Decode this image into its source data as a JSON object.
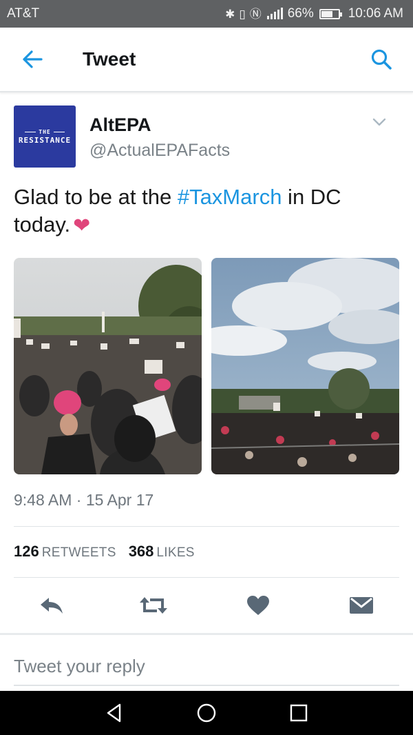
{
  "status_bar": {
    "carrier": "AT&T",
    "battery_text": "66%",
    "battery_level": 0.66,
    "time": "10:06 AM",
    "icons": [
      "bluetooth-icon",
      "vibrate-icon",
      "nfc-icon",
      "signal-icon",
      "battery-icon"
    ]
  },
  "header": {
    "title": "Tweet",
    "back_icon": "back-arrow-icon",
    "search_icon": "search-icon",
    "accent": "#1b95e0"
  },
  "tweet": {
    "avatar": {
      "line1": "THE",
      "line2": "RESISTANCE",
      "bg": "#2b3a9f"
    },
    "author_name": "AltEPA",
    "author_handle": "@ActualEPAFacts",
    "text_before": "Glad to be at the ",
    "hashtag": "#TaxMarch",
    "text_after": " in DC today.",
    "emoji": "❤",
    "photos": [
      "crowd-photo-capitol",
      "crowd-photo-sky"
    ],
    "timestamp": "9:48 AM · 15 Apr 17",
    "retweets_count": "126",
    "retweets_label": "RETWEETS",
    "likes_count": "368",
    "likes_label": "LIKES",
    "actions": [
      "reply-icon",
      "retweet-icon",
      "like-icon",
      "direct-message-icon"
    ]
  },
  "reply": {
    "placeholder": "Tweet your reply"
  },
  "nav": {
    "buttons": [
      "back-triangle-icon",
      "home-circle-icon",
      "recents-square-icon"
    ]
  }
}
